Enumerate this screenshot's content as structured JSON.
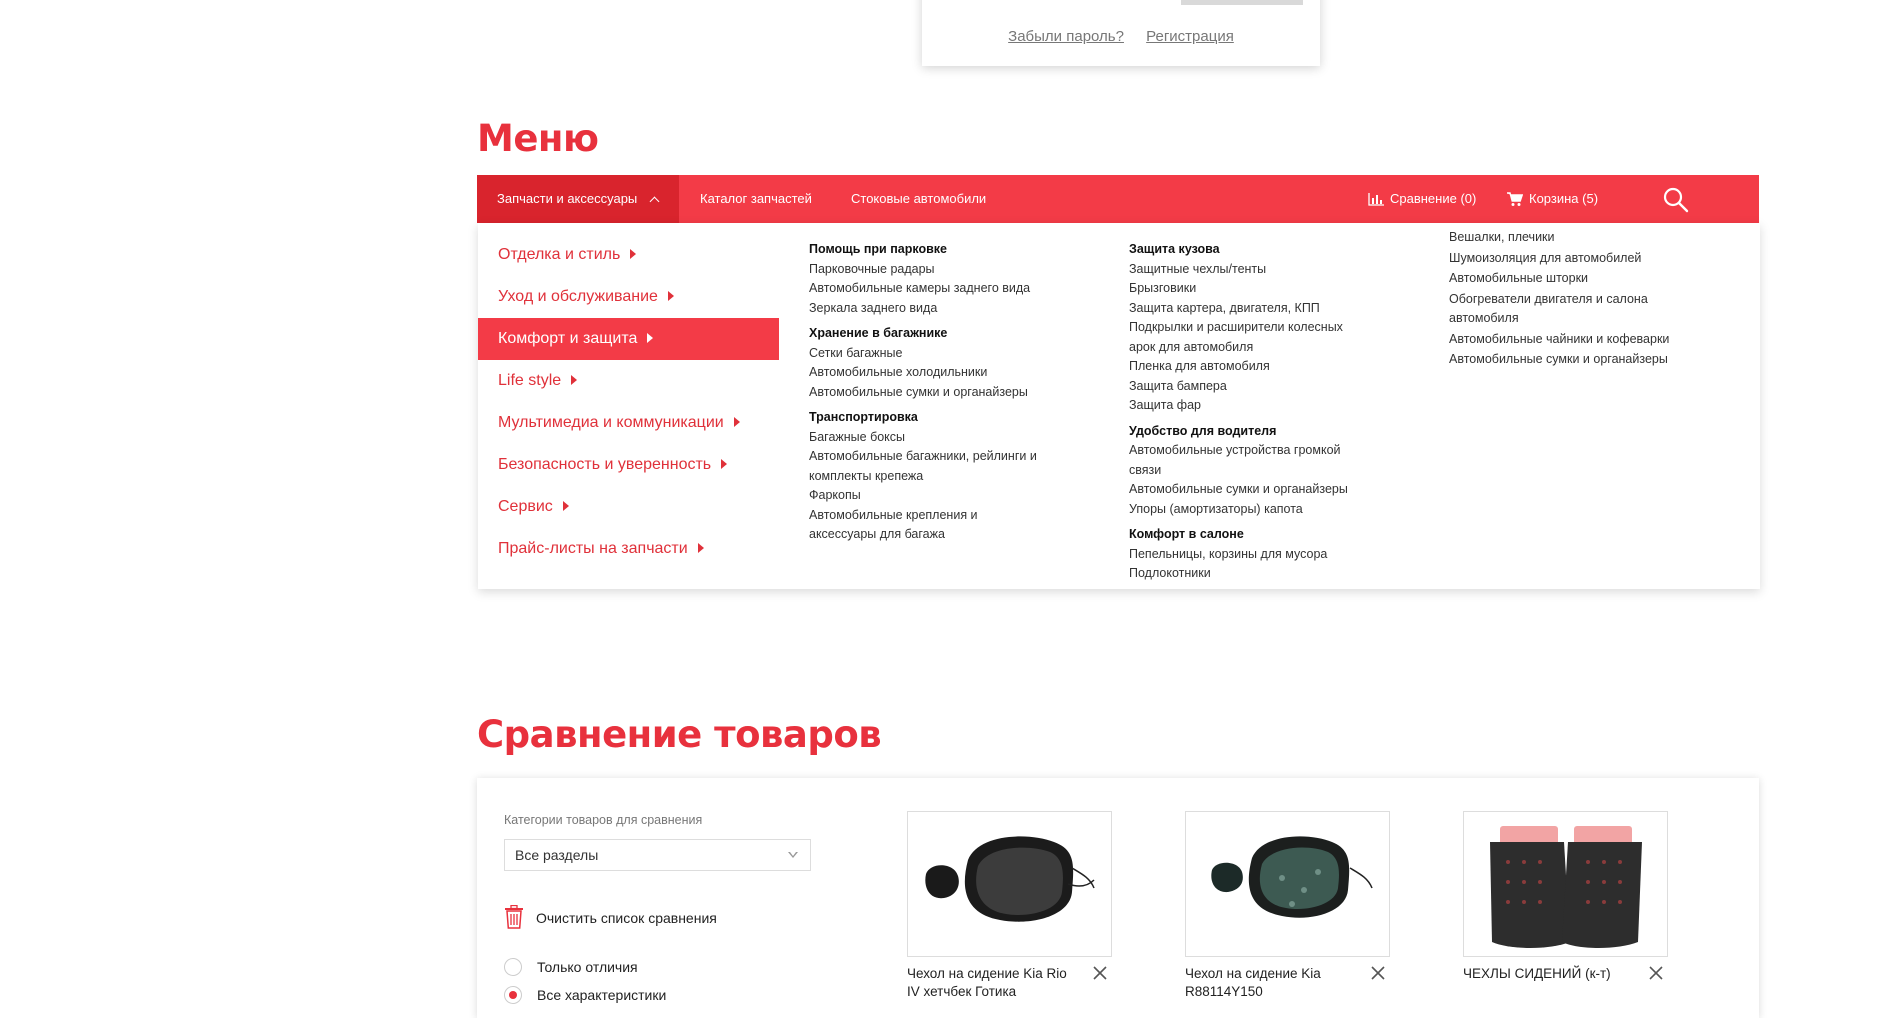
{
  "login": {
    "forgot_label": "Забыли пароль?",
    "register_label": "Регистрация"
  },
  "menu_section": {
    "title": "Меню"
  },
  "menubar": {
    "tabs": [
      "Запчасти и аксессуары",
      "Каталог запчастей",
      "Стоковые автомобили"
    ],
    "compare_label": "Сравнение (0)",
    "cart_label": "Корзина (5)",
    "icons": {
      "compare": "bar-chart-icon",
      "cart": "cart-icon",
      "search": "search-icon"
    }
  },
  "dropdown": {
    "side": [
      "Отделка и стиль",
      "Уход и обслуживание",
      "Комфорт и защита",
      "Life style",
      "Мультимедиа и коммуникации",
      "Безопасность и уверенность",
      "Сервис",
      "Прайс-листы на запчасти"
    ],
    "active_side": "Комфорт и защита",
    "col1": [
      {
        "header": "Помощь при парковке",
        "links": [
          "Парковочные радары",
          "Автомобильные камеры заднего вида",
          "Зеркала заднего вида"
        ]
      },
      {
        "header": "Хранение в багажнике",
        "links": [
          "Сетки багажные",
          "Автомобильные холодильники",
          "Автомобильные сумки и органайзеры"
        ]
      },
      {
        "header": "Транспортировка",
        "links": [
          "Багажные боксы",
          "Автомобильные багажники, рейлинги и комплекты крепежа",
          "Фаркопы",
          "Автомобильные крепления и аксессуары для багажа"
        ]
      }
    ],
    "col2": [
      {
        "header": "Защита кузова",
        "links": [
          "Защитные чехлы/тенты",
          "Брызговики",
          "Защита картера, двигателя, КПП",
          "Подкрылки и расширители колесных арок для автомобиля",
          "Пленка для автомобиля",
          "Защита бампера",
          "Защита фар"
        ]
      },
      {
        "header": "Удобство для водителя",
        "links": [
          "Автомобильные устройства громкой связи",
          "Автомобильные сумки и органайзеры",
          "Упоры (амортизаторы) капота"
        ]
      },
      {
        "header": "Комфорт в салоне",
        "links": [
          "Пепельницы, корзины для мусора",
          "Подлокотники"
        ]
      }
    ],
    "col3": [
      "Вешалки, плечики",
      "Шумоизоляция для автомобилей",
      "Автомобильные шторки",
      "Обогреватели двигателя и салона автомобиля",
      "Автомобильные чайники и кофеварки",
      "Автомобильные сумки и органайзеры"
    ]
  },
  "compare_section": {
    "title": "Сравнение товаров",
    "category_label": "Категории товаров для сравнения",
    "select_value": "Все разделы",
    "clear_label": "Очистить список сравнения",
    "radio_diff": "Только отличия",
    "radio_all": "Все характеристики",
    "selected_radio": "Все характеристики",
    "products": [
      {
        "name": "Чехол на сидение Kia Rio IV хетчбек Готика"
      },
      {
        "name": "Чехол на сидение Kia R88114Y150"
      },
      {
        "name": "ЧЕХЛЫ СИДЕНИЙ (к-т)"
      }
    ]
  },
  "colors": {
    "accent": "#f33b47",
    "accent_dark": "#d9242d",
    "title_red": "#e8313d"
  }
}
